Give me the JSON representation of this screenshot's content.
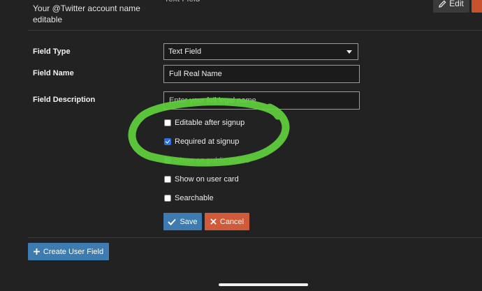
{
  "previous_field": {
    "description_line1": "Your @Twitter account name",
    "description_line2": "editable",
    "type": "Text Field",
    "edit_label": "Edit"
  },
  "form": {
    "field_type_label": "Field Type",
    "field_type_value": "Text Field",
    "field_name_label": "Field Name",
    "field_name_value": "Full Real Name",
    "field_description_label": "Field Description",
    "field_description_value": "Enter your full legal name",
    "options": [
      {
        "label": "Editable after signup",
        "checked": false
      },
      {
        "label": "Required at signup",
        "checked": true
      },
      {
        "label": "Show on public profile",
        "checked": false
      },
      {
        "label": "Show on user card",
        "checked": false
      },
      {
        "label": "Searchable",
        "checked": false
      }
    ],
    "save_label": "Save",
    "cancel_label": "Cancel"
  },
  "create_label": "Create User Field",
  "colors": {
    "background": "#222222",
    "primary_button": "#3d7bb0",
    "danger_button": "#d05a3a",
    "annotation": "#5fd13d"
  }
}
